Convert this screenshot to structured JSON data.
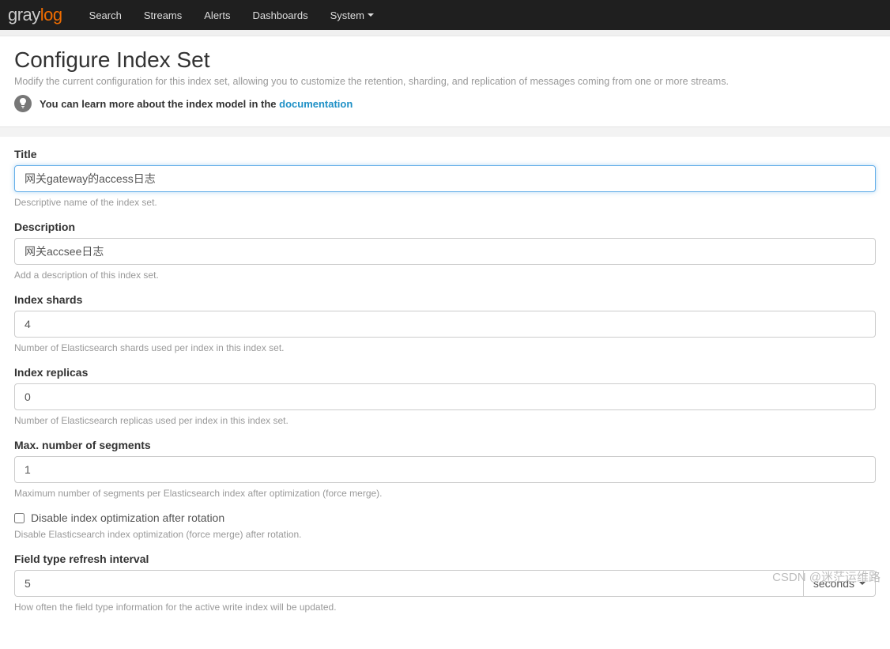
{
  "logo": {
    "gray": "gray",
    "orange": "log"
  },
  "nav": {
    "search": "Search",
    "streams": "Streams",
    "alerts": "Alerts",
    "dashboards": "Dashboards",
    "system": "System"
  },
  "header": {
    "title": "Configure Index Set",
    "subtitle": "Modify the current configuration for this index set, allowing you to customize the retention, sharding, and replication of messages coming from one or more streams.",
    "info_prefix": "You can learn more about the index model in the ",
    "info_link": "documentation"
  },
  "form": {
    "title": {
      "label": "Title",
      "value": "网关gateway的access日志",
      "help": "Descriptive name of the index set."
    },
    "description": {
      "label": "Description",
      "value": "网关accsee日志",
      "help": "Add a description of this index set."
    },
    "shards": {
      "label": "Index shards",
      "value": "4",
      "help": "Number of Elasticsearch shards used per index in this index set."
    },
    "replicas": {
      "label": "Index replicas",
      "value": "0",
      "help": "Number of Elasticsearch replicas used per index in this index set."
    },
    "segments": {
      "label": "Max. number of segments",
      "value": "1",
      "help": "Maximum number of segments per Elasticsearch index after optimization (force merge)."
    },
    "disable_opt": {
      "label": "Disable index optimization after rotation",
      "checked": false,
      "help": "Disable Elasticsearch index optimization (force merge) after rotation."
    },
    "refresh": {
      "label": "Field type refresh interval",
      "value": "5",
      "unit": "seconds",
      "help": "How often the field type information for the active write index will be updated."
    }
  },
  "watermark": "CSDN @迷茫运维路"
}
